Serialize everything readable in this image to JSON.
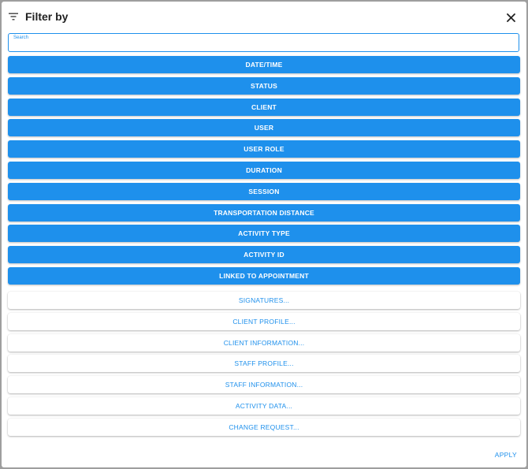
{
  "header": {
    "title": "Filter by"
  },
  "search": {
    "label": "Search",
    "value": ""
  },
  "filters": [
    "DATE/TIME",
    "STATUS",
    "CLIENT",
    "USER",
    "USER ROLE",
    "DURATION",
    "SESSION",
    "TRANSPORTATION DISTANCE",
    "ACTIVITY TYPE",
    "ACTIVITY ID",
    "LINKED TO APPOINTMENT"
  ],
  "more_filters": [
    "SIGNATURES...",
    "CLIENT PROFILE...",
    "CLIENT INFORMATION...",
    "STAFF PROFILE...",
    "STAFF INFORMATION...",
    "ACTIVITY DATA...",
    "CHANGE REQUEST..."
  ],
  "footer": {
    "apply_label": "APPLY"
  },
  "colors": {
    "accent": "#1e90ec",
    "overlay": "#9e9e9e"
  },
  "icons": {
    "filter": "filter-list-icon",
    "close": "close-icon"
  }
}
